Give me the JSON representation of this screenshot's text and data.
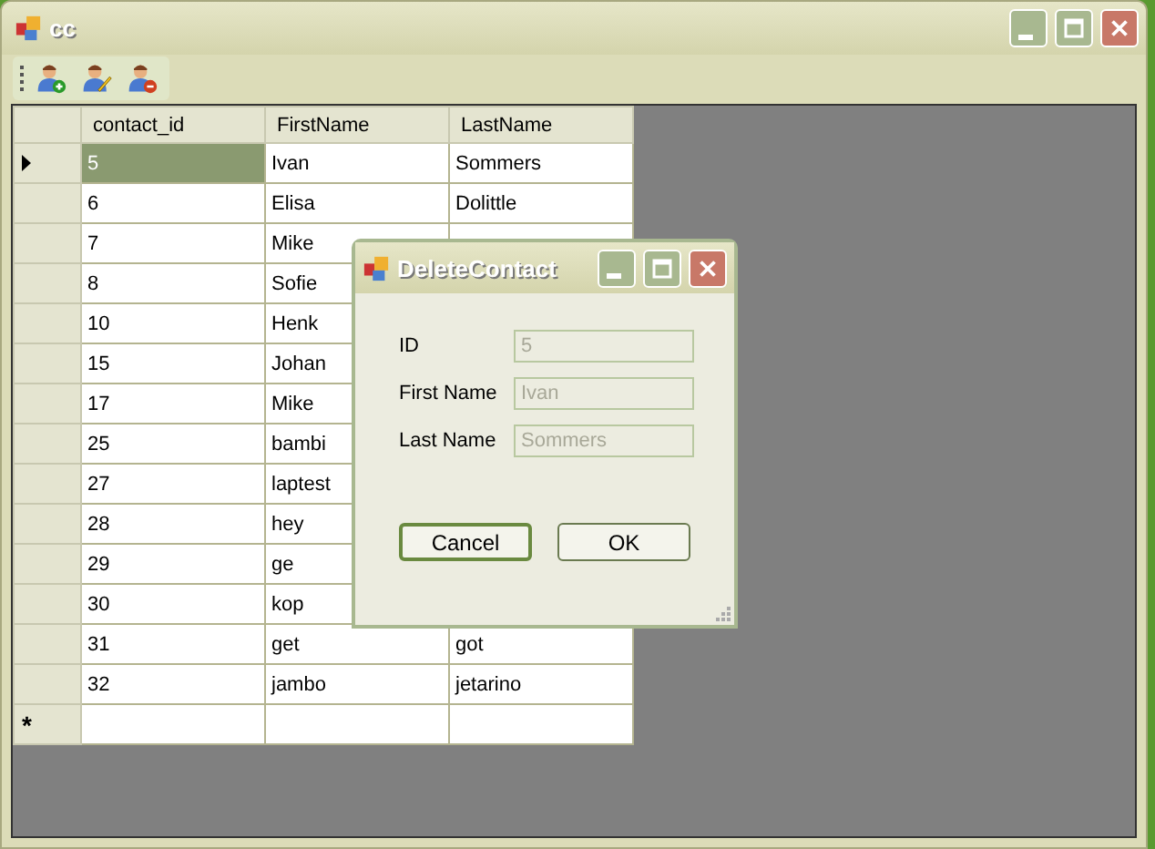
{
  "window": {
    "title": "cc"
  },
  "toolbar": {
    "buttons": [
      {
        "kind": "add"
      },
      {
        "kind": "edit"
      },
      {
        "kind": "delete"
      }
    ]
  },
  "table": {
    "columns": [
      "contact_id",
      "FirstName",
      "LastName"
    ],
    "rows": [
      {
        "contact_id": "5",
        "first_name": "Ivan",
        "last_name": "Sommers",
        "selected": true
      },
      {
        "contact_id": "6",
        "first_name": "Elisa",
        "last_name": "Dolittle",
        "selected": false
      },
      {
        "contact_id": "7",
        "first_name": "Mike",
        "selected": false
      },
      {
        "contact_id": "8",
        "first_name": "Sofie",
        "selected": false
      },
      {
        "contact_id": "10",
        "first_name": "Henk",
        "selected": false
      },
      {
        "contact_id": "15",
        "first_name": "Johan",
        "selected": false
      },
      {
        "contact_id": "17",
        "first_name": "Mike",
        "selected": false
      },
      {
        "contact_id": "25",
        "first_name": "bambi",
        "selected": false
      },
      {
        "contact_id": "27",
        "first_name": "laptest",
        "selected": false
      },
      {
        "contact_id": "28",
        "first_name": "hey",
        "selected": false
      },
      {
        "contact_id": "29",
        "first_name": "ge",
        "selected": false
      },
      {
        "contact_id": "30",
        "first_name": "kop",
        "selected": false
      },
      {
        "contact_id": "31",
        "first_name": "get",
        "last_name": "got",
        "selected": false
      },
      {
        "contact_id": "32",
        "first_name": "jambo",
        "last_name": "jetarino",
        "selected": false
      }
    ],
    "new_row_marker": "*"
  },
  "dialog": {
    "title": "DeleteContact",
    "fields": [
      {
        "label": "ID",
        "value": "5",
        "disabled": true
      },
      {
        "label": "First Name",
        "value": "Ivan",
        "disabled": true
      },
      {
        "label": "Last Name",
        "value": "Sommers",
        "disabled": true
      }
    ],
    "buttons": [
      {
        "label": "Cancel",
        "default": true
      },
      {
        "label": "OK",
        "default": false
      }
    ]
  }
}
